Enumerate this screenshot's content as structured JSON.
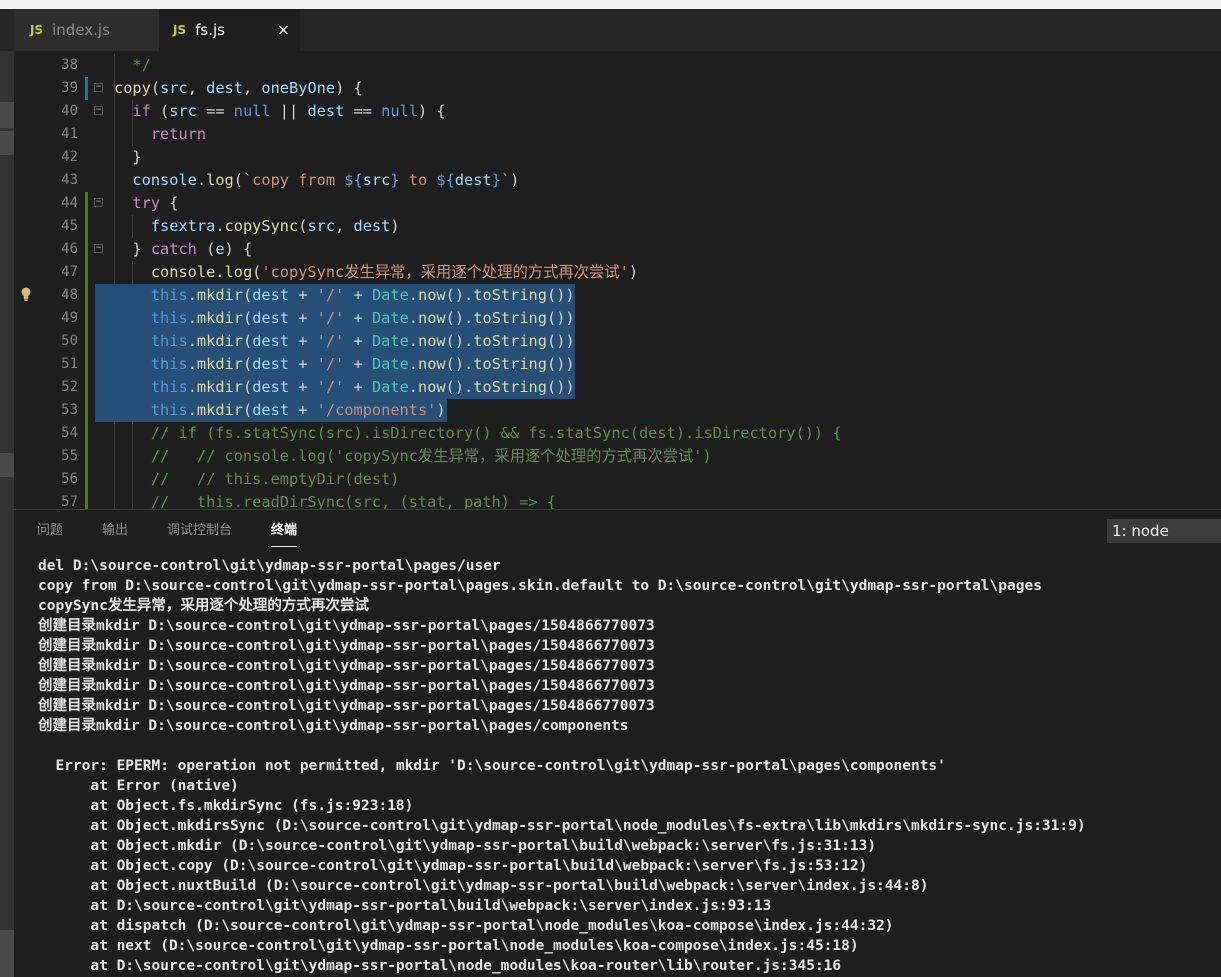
{
  "tabs": [
    {
      "icon": "JS",
      "label": "index.js",
      "active": false
    },
    {
      "icon": "JS",
      "label": "fs.js",
      "active": true,
      "close": "×"
    }
  ],
  "editor": {
    "lines": [
      {
        "num": "38",
        "text": "  */"
      },
      {
        "num": "39",
        "text": "copy(src, dest, oneByOne) {"
      },
      {
        "num": "40",
        "text": "  if (src == null || dest == null) {"
      },
      {
        "num": "41",
        "text": "    return"
      },
      {
        "num": "42",
        "text": "  }"
      },
      {
        "num": "43",
        "text": "  console.log(`copy from ${src} to ${dest}`)"
      },
      {
        "num": "44",
        "text": "  try {"
      },
      {
        "num": "45",
        "text": "    fsextra.copySync(src, dest)"
      },
      {
        "num": "46",
        "text": "  } catch (e) {"
      },
      {
        "num": "47",
        "text": "    console.log('copySync发生异常，采用逐个处理的方式再次尝试')"
      },
      {
        "num": "48",
        "text": "    this.mkdir(dest + '/' + Date.now().toString())"
      },
      {
        "num": "49",
        "text": "    this.mkdir(dest + '/' + Date.now().toString())"
      },
      {
        "num": "50",
        "text": "    this.mkdir(dest + '/' + Date.now().toString())"
      },
      {
        "num": "51",
        "text": "    this.mkdir(dest + '/' + Date.now().toString())"
      },
      {
        "num": "52",
        "text": "    this.mkdir(dest + '/' + Date.now().toString())"
      },
      {
        "num": "53",
        "text": "    this.mkdir(dest + '/components')"
      },
      {
        "num": "54",
        "text": "    // if (fs.statSync(src).isDirectory() && fs.statSync(dest).isDirectory()) {"
      },
      {
        "num": "55",
        "text": "    //   // console.log('copySync发生异常，采用逐个处理的方式再次尝试')"
      },
      {
        "num": "56",
        "text": "    //   // this.emptyDir(dest)"
      },
      {
        "num": "57",
        "text": "    //   this.readDirSync(src, (stat, path) => {"
      }
    ]
  },
  "panel": {
    "tabs": [
      "问题",
      "输出",
      "调试控制台",
      "终端"
    ],
    "active_tab": "终端",
    "terminal_select": "1: node",
    "terminal_lines": [
      "del D:\\source-control\\git\\ydmap-ssr-portal\\pages/user",
      "copy from D:\\source-control\\git\\ydmap-ssr-portal\\pages.skin.default to D:\\source-control\\git\\ydmap-ssr-portal\\pages",
      "copySync发生异常，采用逐个处理的方式再次尝试",
      "创建目录mkdir D:\\source-control\\git\\ydmap-ssr-portal\\pages/1504866770073",
      "创建目录mkdir D:\\source-control\\git\\ydmap-ssr-portal\\pages/1504866770073",
      "创建目录mkdir D:\\source-control\\git\\ydmap-ssr-portal\\pages/1504866770073",
      "创建目录mkdir D:\\source-control\\git\\ydmap-ssr-portal\\pages/1504866770073",
      "创建目录mkdir D:\\source-control\\git\\ydmap-ssr-portal\\pages/1504866770073",
      "创建目录mkdir D:\\source-control\\git\\ydmap-ssr-portal\\pages/components",
      "",
      "  Error: EPERM: operation not permitted, mkdir 'D:\\source-control\\git\\ydmap-ssr-portal\\pages\\components'",
      "      at Error (native)",
      "      at Object.fs.mkdirSync (fs.js:923:18)",
      "      at Object.mkdirsSync (D:\\source-control\\git\\ydmap-ssr-portal\\node_modules\\fs-extra\\lib\\mkdirs\\mkdirs-sync.js:31:9)",
      "      at Object.mkdir (D:\\source-control\\git\\ydmap-ssr-portal\\build\\webpack:\\server\\fs.js:31:13)",
      "      at Object.copy (D:\\source-control\\git\\ydmap-ssr-portal\\build\\webpack:\\server\\fs.js:53:12)",
      "      at Object.nuxtBuild (D:\\source-control\\git\\ydmap-ssr-portal\\build\\webpack:\\server\\index.js:44:8)",
      "      at D:\\source-control\\git\\ydmap-ssr-portal\\build\\webpack:\\server\\index.js:93:13",
      "      at dispatch (D:\\source-control\\git\\ydmap-ssr-portal\\node_modules\\koa-compose\\index.js:44:32)",
      "      at next (D:\\source-control\\git\\ydmap-ssr-portal\\node_modules\\koa-compose\\index.js:45:18)",
      "      at D:\\source-control\\git\\ydmap-ssr-portal\\node_modules\\koa-router\\lib\\router.js:345:16"
    ]
  }
}
